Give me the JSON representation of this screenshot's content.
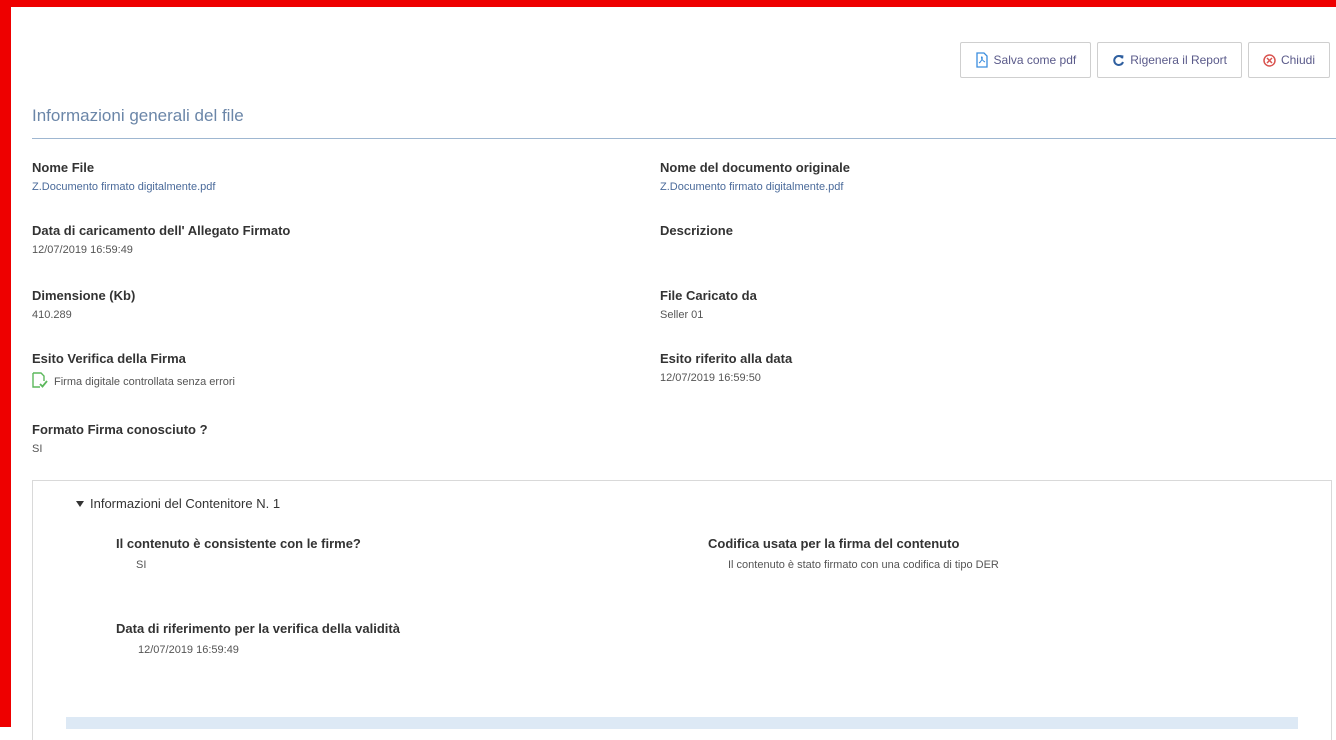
{
  "toolbar": {
    "save_pdf": "Salva come pdf",
    "regenerate": "Rigenera il Report",
    "close": "Chiudi"
  },
  "section": {
    "title": "Informazioni generali del file"
  },
  "fields": {
    "nome_file": {
      "label": "Nome File",
      "value": "Z.Documento firmato digitalmente.pdf"
    },
    "nome_doc_originale": {
      "label": "Nome del documento originale",
      "value": "Z.Documento firmato digitalmente.pdf"
    },
    "data_caricamento": {
      "label": "Data di caricamento dell' Allegato Firmato",
      "value": "12/07/2019 16:59:49"
    },
    "descrizione": {
      "label": "Descrizione",
      "value": ""
    },
    "dimensione": {
      "label": "Dimensione (Kb)",
      "value": "410.289"
    },
    "caricato_da": {
      "label": "File Caricato da",
      "value": "Seller 01"
    },
    "esito_verifica": {
      "label": "Esito Verifica della Firma",
      "value": "Firma digitale controllata senza errori"
    },
    "esito_data": {
      "label": "Esito riferito alla data",
      "value": "12/07/2019 16:59:50"
    },
    "formato_firma": {
      "label": "Formato Firma conosciuto ?",
      "value": "SI"
    }
  },
  "container": {
    "header": "Informazioni del Contenitore N. 1",
    "consistente": {
      "label": "Il contenuto è consistente con le firme?",
      "value": "SI"
    },
    "codifica": {
      "label": "Codifica usata per la firma del contenuto",
      "value": "Il contenuto è stato firmato con una codifica di tipo DER"
    },
    "data_riferimento": {
      "label": "Data di riferimento per la verifica della validità",
      "value": "12/07/2019 16:59:49"
    }
  },
  "colors": {
    "frame": "#ee0000",
    "accent": "#6b86a8",
    "link": "#4a6a9a",
    "success": "#5cb85c",
    "danger": "#d9534f"
  },
  "icons": {
    "save_pdf": "pdf-file-icon",
    "regenerate": "refresh-icon",
    "close": "close-circle-icon",
    "verify": "verified-document-icon",
    "collapse": "caret-down-icon"
  }
}
